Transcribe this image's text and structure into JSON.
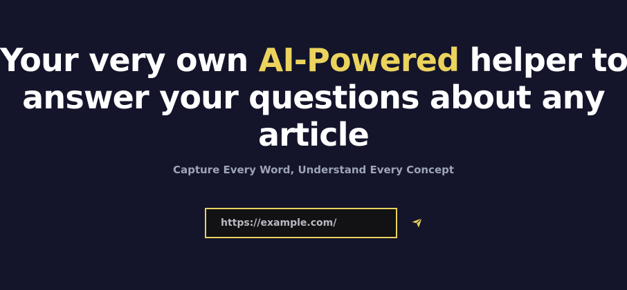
{
  "headline": {
    "line1_before": "Your very own ",
    "line1_accent": "AI-Powered",
    "line1_after": " helper to",
    "line2": "answer your questions about any",
    "line3": "article"
  },
  "subtitle": "Capture Every Word, Understand Every Concept",
  "url_form": {
    "placeholder": "https://example.com/",
    "value": "",
    "send_icon": "paper-plane-icon"
  },
  "colors": {
    "background": "#14142b",
    "accent": "#ebd35d",
    "headline_text": "#ffffff",
    "subtitle_text": "#9ea4b8",
    "input_background": "#121214"
  }
}
